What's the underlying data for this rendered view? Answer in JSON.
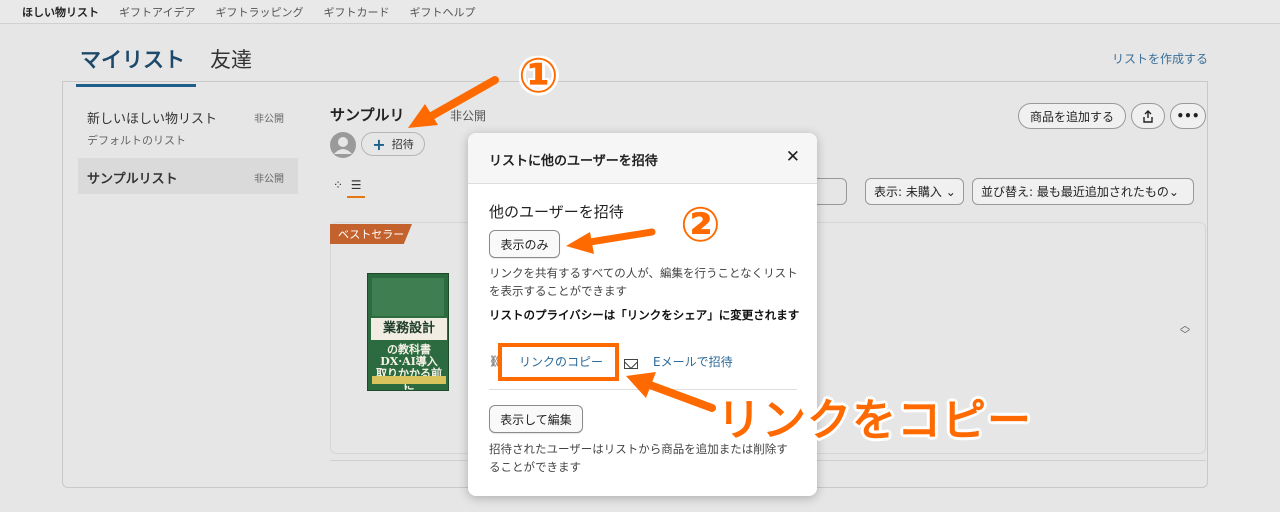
{
  "topnav": {
    "items": [
      "ほしい物リスト",
      "ギフトアイデア",
      "ギフトラッピング",
      "ギフトカード",
      "ギフトヘルプ"
    ]
  },
  "tabs": {
    "mylist": "マイリスト",
    "friends": "友達"
  },
  "create_list": "リストを作成する",
  "sidebar": {
    "items": [
      {
        "name": "新しいほしい物リスト",
        "sub": "デフォルトのリスト",
        "privacy": "非公開"
      },
      {
        "name": "サンプルリスト",
        "sub": "",
        "privacy": "非公開"
      }
    ]
  },
  "list": {
    "title": "サンプルリ",
    "privacy": "非公開",
    "invite": "招待",
    "add_item": "商品を追加する",
    "more": "•••",
    "filter_show": "表示: 未購入",
    "sort": "並び替え: 最も最近追加されたもの",
    "badge": "ベストセラー"
  },
  "book": {
    "title": "業務設計",
    "line1": "の教科書",
    "line2": "DX·AI導入",
    "line3": "取りかかる前に"
  },
  "modal": {
    "title": "リストに他のユーザーを招待",
    "close": "✕",
    "subtitle": "他のユーザーを招待",
    "view_only_btn": "表示のみ",
    "view_only_desc": "リンクを共有するすべての人が、編集を行うことなくリストを表示することができます",
    "privacy_note": "リストのプライバシーは「リンクをシェア」に変更されます",
    "copy_link": "リンクのコピー",
    "email_invite": "Eメールで招待",
    "view_edit_btn": "表示して編集",
    "view_edit_desc": "招待されたユーザーはリストから商品を追加または削除することができます"
  },
  "annotations": {
    "step1": "①",
    "step2": "②",
    "copy_label": "リンクをコピー",
    "accent": "#ff6a00"
  }
}
